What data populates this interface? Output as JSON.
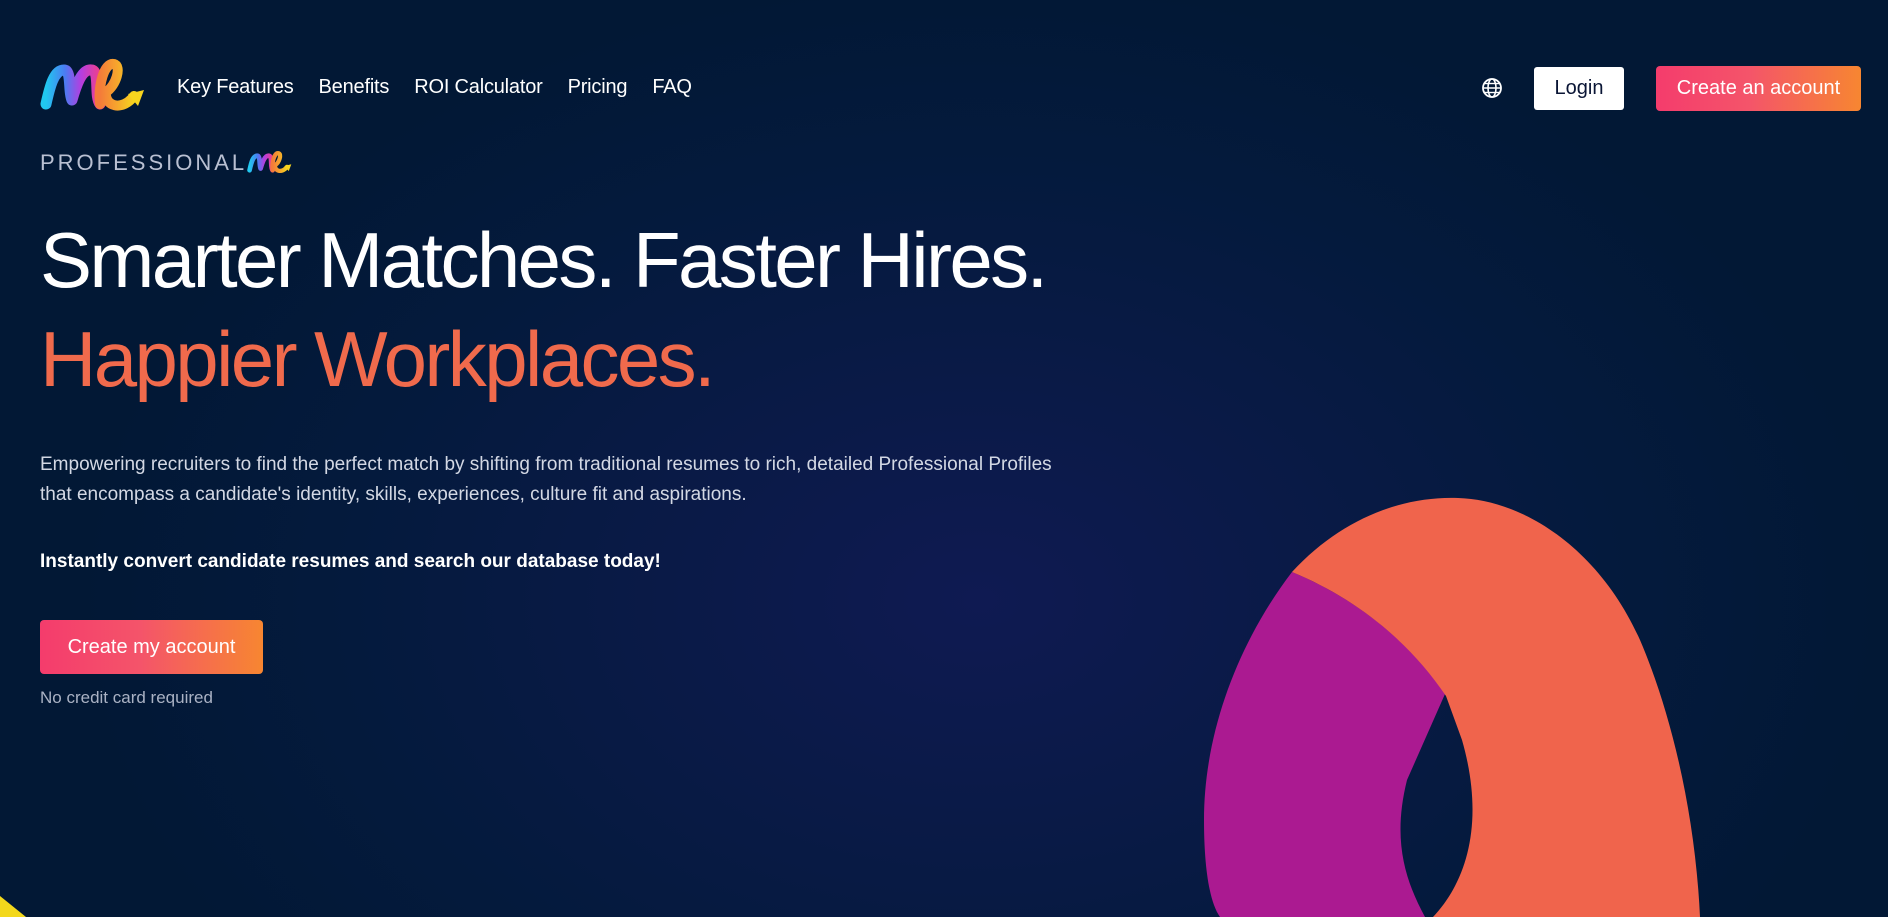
{
  "header": {
    "logo_icon": "me-logo-icon",
    "nav": [
      {
        "label": "Key Features"
      },
      {
        "label": "Benefits"
      },
      {
        "label": "ROI Calculator"
      },
      {
        "label": "Pricing"
      },
      {
        "label": "FAQ"
      }
    ],
    "globe_icon": "globe-icon",
    "login_label": "Login",
    "create_account_label": "Create an account"
  },
  "hero": {
    "brand_text": "PROFESSIONAL",
    "headline_line1": "Smarter Matches. Faster Hires.",
    "headline_line2": "Happier Workplaces.",
    "description": "Empowering recruiters to find the perfect match by shifting from traditional resumes to rich, detailed Professional Profiles that encompass a candidate's identity, skills, experiences, culture fit and aspirations.",
    "cta_text": "Instantly convert candidate resumes and search our database today!",
    "button_label": "Create my account",
    "note": "No credit card required"
  },
  "colors": {
    "background": "#021835",
    "accent_orange": "#f06a4c",
    "gradient_start": "#f43c6c",
    "gradient_end": "#f78631",
    "ring_orange": "#f0644c",
    "ring_magenta": "#ab1a91",
    "corner_yellow": "#f3d81c"
  }
}
